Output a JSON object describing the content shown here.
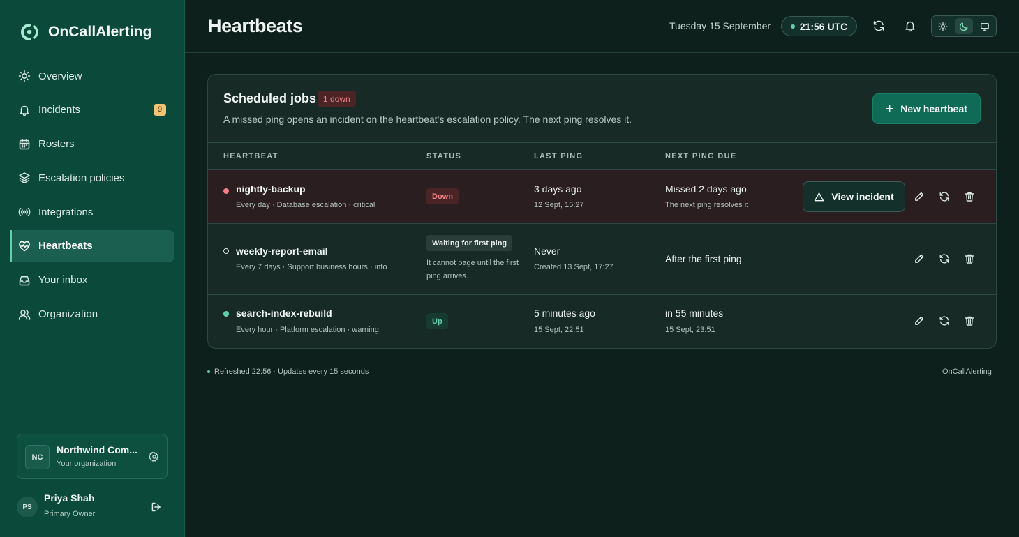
{
  "brand": {
    "name": "OnCallAlerting"
  },
  "nav": [
    {
      "label": "Overview",
      "icon": "sun-icon"
    },
    {
      "label": "Incidents",
      "icon": "bell-icon",
      "badge": "9"
    },
    {
      "label": "Rosters",
      "icon": "calendar-icon"
    },
    {
      "label": "Escalation policies",
      "icon": "layers-icon"
    },
    {
      "label": "Integrations",
      "icon": "broadcast-icon"
    },
    {
      "label": "Heartbeats",
      "icon": "heart-pulse-icon",
      "active": true
    },
    {
      "label": "Your inbox",
      "icon": "inbox-icon"
    },
    {
      "label": "Organization",
      "icon": "users-icon"
    }
  ],
  "org": {
    "initials": "NC",
    "name": "Northwind Com...",
    "subtitle": "Your organization"
  },
  "user": {
    "initials": "PS",
    "name": "Priya Shah",
    "role": "Primary Owner"
  },
  "header": {
    "title": "Heartbeats",
    "date": "Tuesday 15 September",
    "time": "21:56 UTC"
  },
  "card": {
    "title": "Scheduled jobs",
    "down_badge": "1 down",
    "description": "A missed ping opens an incident on the heartbeat's escalation policy. The next ping resolves it.",
    "new_button": "New heartbeat",
    "columns": {
      "heartbeat": "HEARTBEAT",
      "status": "STATUS",
      "last_ping": "LAST PING",
      "next_ping": "NEXT PING DUE"
    }
  },
  "rows": [
    {
      "name": "nightly-backup",
      "meta": "Every day · Database escalation · critical",
      "status": "Down",
      "status_note": "",
      "last_ping": "3 days ago",
      "last_ping_sub": "12 Sept, 15:27",
      "next_ping": "Missed 2 days ago",
      "next_ping_sub": "The next ping resolves it",
      "view_incident": "View incident"
    },
    {
      "name": "weekly-report-email",
      "meta": "Every 7 days · Support business hours · info",
      "status": "Waiting for first ping",
      "status_note": "It cannot page until the first ping arrives.",
      "last_ping": "Never",
      "last_ping_sub": "Created 13 Sept, 17:27",
      "next_ping": "After the first ping",
      "next_ping_sub": ""
    },
    {
      "name": "search-index-rebuild",
      "meta": "Every hour · Platform escalation · warning",
      "status": "Up",
      "status_note": "",
      "last_ping": "5 minutes ago",
      "last_ping_sub": "15 Sept, 22:51",
      "next_ping": "in 55 minutes",
      "next_ping_sub": "15 Sept, 23:51"
    }
  ],
  "footer": {
    "refresh": "Refreshed 22:56 · Updates every 15 seconds",
    "brand": "OnCallAlerting"
  },
  "colors": {
    "accent": "#5fd0a8",
    "down": "#f07f85",
    "sidebar": "#0b4a3b",
    "background": "#0e201c"
  }
}
